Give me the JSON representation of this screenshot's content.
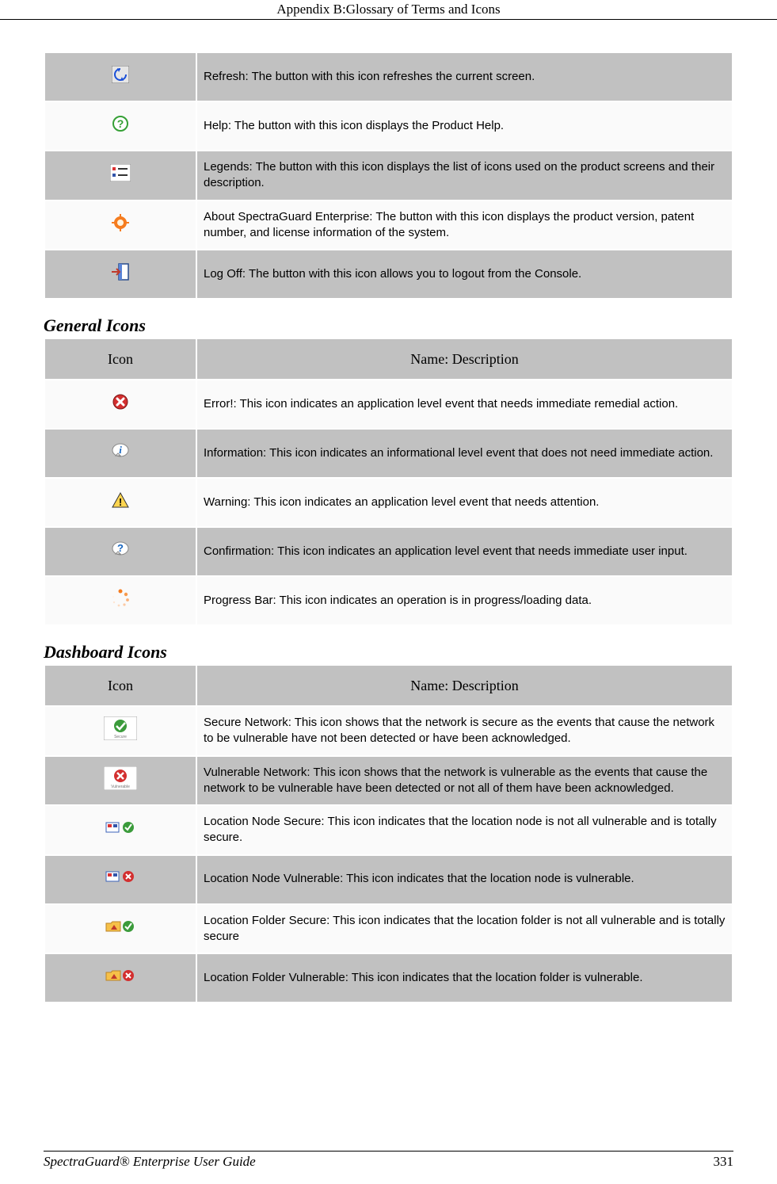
{
  "header": {
    "title": "Appendix B:Glossary of Terms and Icons"
  },
  "tables": {
    "buttons": {
      "rows": [
        {
          "icon": "refresh-icon",
          "desc": "Refresh: The button with this icon refreshes the current screen."
        },
        {
          "icon": "help-icon",
          "desc": "Help: The button with this icon displays the Product Help."
        },
        {
          "icon": "legends-icon",
          "desc": "Legends: The button with this icon displays the list of icons used on the product screens and their description."
        },
        {
          "icon": "about-icon",
          "desc": "About SpectraGuard Enterprise: The button with this icon displays the product version, patent number, and license information of the system."
        },
        {
          "icon": "logoff-icon",
          "desc": "Log Off: The button with this icon allows you to logout from the Console."
        }
      ]
    },
    "general": {
      "heading": "General Icons",
      "col1": "Icon",
      "col2": "Name: Description",
      "rows": [
        {
          "icon": "error-icon",
          "desc": "Error!: This icon indicates an application level event that needs immediate remedial action."
        },
        {
          "icon": "info-icon",
          "desc": "Information: This icon indicates an informational level event that does not need immediate action."
        },
        {
          "icon": "warning-icon",
          "desc": "Warning: This icon indicates an application level event that needs attention."
        },
        {
          "icon": "confirm-icon",
          "desc": "Confirmation: This icon indicates an application level event that needs immediate user input."
        },
        {
          "icon": "progress-icon",
          "desc": "Progress Bar: This icon indicates an operation is in progress/loading data."
        }
      ]
    },
    "dashboard": {
      "heading": "Dashboard Icons",
      "col1": "Icon",
      "col2": "Name: Description",
      "rows": [
        {
          "icon": "secure-network-icon",
          "desc": "Secure Network: This icon shows that the network is secure as the events that cause the network to be vulnerable have not been detected or have been acknowledged."
        },
        {
          "icon": "vulnerable-network-icon",
          "desc": "Vulnerable Network: This icon shows that the network is vulnerable as the events that cause the network to be vulnerable have been detected or not all of them have been acknowledged."
        },
        {
          "icon": "location-node-secure-icon",
          "desc": "Location Node Secure: This icon indicates that the location node is not all vulnerable and is totally secure."
        },
        {
          "icon": "location-node-vulnerable-icon",
          "desc": "Location Node Vulnerable: This icon indicates that the location node is vulnerable."
        },
        {
          "icon": "location-folder-secure-icon",
          "desc": "Location Folder Secure: This icon indicates that the location folder is not all vulnerable and is totally secure"
        },
        {
          "icon": "location-folder-vulnerable-icon",
          "desc": "Location Folder Vulnerable: This icon indicates that the location folder is vulnerable."
        }
      ]
    }
  },
  "footer": {
    "left": "SpectraGuard®  Enterprise User Guide",
    "right": "331"
  }
}
